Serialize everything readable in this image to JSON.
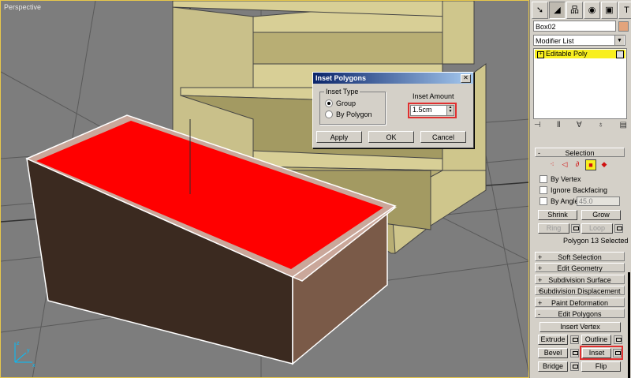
{
  "viewport": {
    "label": "Perspective"
  },
  "dialog": {
    "title": "Inset Polygons",
    "close": "✕",
    "group_label": "Inset Type",
    "radio_group": "Group",
    "radio_by_polygon": "By Polygon",
    "selected_type": "Group",
    "amount_label": "Inset Amount",
    "amount_value": "1.5cm",
    "apply": "Apply",
    "ok": "OK",
    "cancel": "Cancel"
  },
  "panel": {
    "tabs": [
      "➘",
      "◢",
      "品",
      "◉",
      "▣",
      "T"
    ],
    "object_name": "Box02",
    "object_color": "#e3a47c",
    "modifier_list": "Modifier List",
    "stack_item": "Editable Poly",
    "stack_item_color": "#f8ef1f",
    "stack_icons": [
      "⊣",
      "Ⅱ",
      "∀",
      "♁",
      "▤"
    ],
    "selection": {
      "title": "Selection",
      "by_vertex": "By Vertex",
      "ignore_backfacing": "Ignore Backfacing",
      "by_angle": "By Angle:",
      "angle_value": "45.0",
      "shrink": "Shrink",
      "grow": "Grow",
      "ring": "Ring",
      "loop": "Loop",
      "status": "Polygon 13 Selected"
    },
    "rollouts": [
      {
        "sign": "+",
        "title": "Soft Selection"
      },
      {
        "sign": "+",
        "title": "Edit Geometry"
      },
      {
        "sign": "+",
        "title": "Subdivision Surface"
      },
      {
        "sign": "+",
        "title": "Subdivision Displacement"
      },
      {
        "sign": "+",
        "title": "Paint Deformation"
      },
      {
        "sign": "-",
        "title": "Edit Polygons"
      }
    ],
    "edit_polygons": {
      "insert_vertex": "Insert Vertex",
      "extrude": "Extrude",
      "outline": "Outline",
      "bevel": "Bevel",
      "inset": "Inset",
      "bridge": "Bridge",
      "flip": "Flip"
    }
  },
  "colors": {
    "highlight": "#e03030",
    "selected_face": "#ff0000"
  }
}
